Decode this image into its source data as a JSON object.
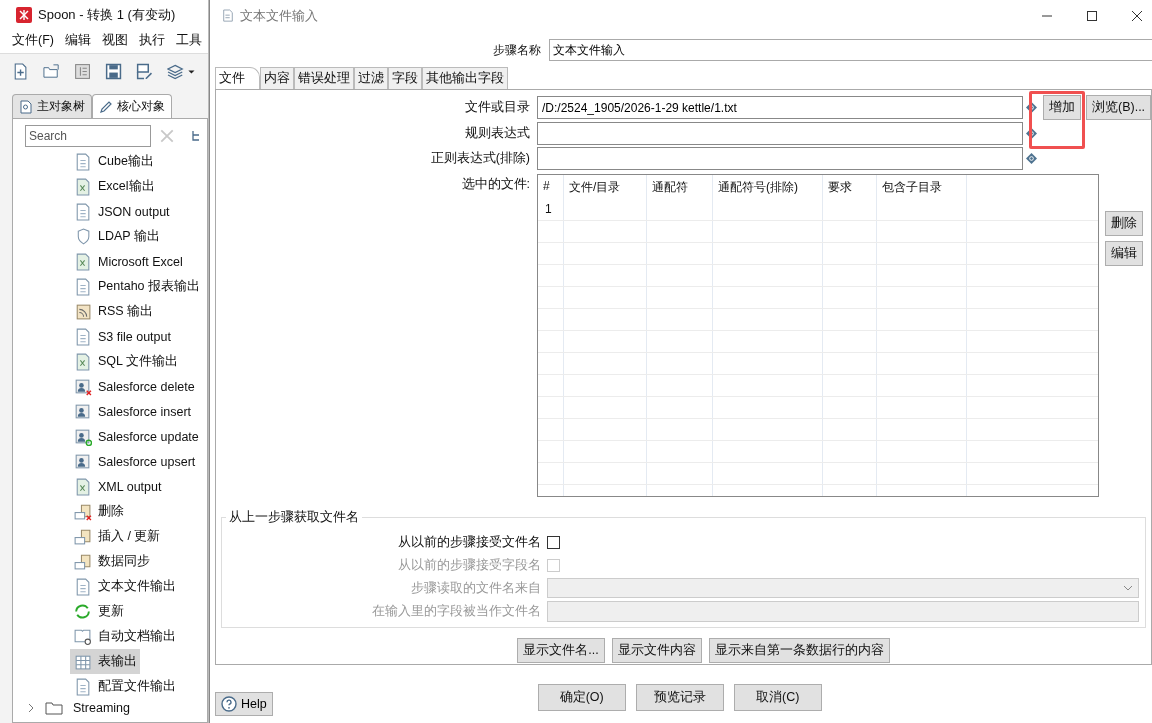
{
  "spoon": {
    "title": "Spoon - 转换 1 (有变动)",
    "menu": [
      "文件(F)",
      "编辑",
      "视图",
      "执行",
      "工具"
    ],
    "tabs": [
      {
        "label": "主对象树",
        "selected": false
      },
      {
        "label": "核心对象",
        "selected": true
      }
    ],
    "search": {
      "placeholder": "Search"
    },
    "tree": [
      {
        "label": "Cube输出",
        "kind": "doc",
        "selected": false
      },
      {
        "label": "Excel输出",
        "kind": "sheet",
        "selected": false
      },
      {
        "label": "JSON output",
        "kind": "doc",
        "selected": false
      },
      {
        "label": "LDAP 输出",
        "kind": "shield",
        "selected": false
      },
      {
        "label": "Microsoft Excel",
        "kind": "sheet",
        "selected": false
      },
      {
        "label": "Pentaho 报表输出",
        "kind": "doc",
        "selected": false
      },
      {
        "label": "RSS 输出",
        "kind": "rss",
        "selected": false
      },
      {
        "label": "S3 file output",
        "kind": "doc",
        "selected": false
      },
      {
        "label": "SQL 文件输出",
        "kind": "sheet",
        "selected": false
      },
      {
        "label": "Salesforce delete",
        "kind": "person-x",
        "selected": false
      },
      {
        "label": "Salesforce insert",
        "kind": "person",
        "selected": false
      },
      {
        "label": "Salesforce update",
        "kind": "person-sync",
        "selected": false
      },
      {
        "label": "Salesforce upsert",
        "kind": "person",
        "selected": false
      },
      {
        "label": "XML output",
        "kind": "sheet",
        "selected": false
      },
      {
        "label": "删除",
        "kind": "db-x",
        "selected": false
      },
      {
        "label": "插入 / 更新",
        "kind": "db",
        "selected": false
      },
      {
        "label": "数据同步",
        "kind": "db",
        "selected": false
      },
      {
        "label": "文本文件输出",
        "kind": "doc",
        "selected": false
      },
      {
        "label": "更新",
        "kind": "refresh",
        "selected": false
      },
      {
        "label": "自动文档输出",
        "kind": "book",
        "selected": false
      },
      {
        "label": "表输出",
        "kind": "table",
        "selected": true
      },
      {
        "label": "配置文件输出",
        "kind": "doc",
        "selected": false
      },
      {
        "label": "Streaming",
        "kind": "folder",
        "expanded": false
      }
    ]
  },
  "dialog": {
    "title": "文本文件输入",
    "step_name": {
      "label": "步骤名称",
      "value": "文本文件输入"
    },
    "tabs": [
      {
        "label": "文件",
        "selected": true
      },
      {
        "label": "内容",
        "selected": false
      },
      {
        "label": "错误处理",
        "selected": false
      },
      {
        "label": "过滤",
        "selected": false
      },
      {
        "label": "字段",
        "selected": false
      },
      {
        "label": "其他输出字段",
        "selected": false
      }
    ],
    "file": {
      "label": "文件或目录",
      "value": "/D:/2524_1905/2026-1-29 kettle/1.txt"
    },
    "regex": {
      "label": "规则表达式"
    },
    "exclude_regex": {
      "label": "正则表达式(排除)"
    },
    "add_button": {
      "label": "增加",
      "highlighted": true
    },
    "browse_button": "浏览(B)...",
    "selected_files": {
      "label": "选中的文件:",
      "columns": [
        "#",
        "文件/目录",
        "通配符",
        "通配符号(排除)",
        "要求",
        "包含子目录"
      ],
      "rows": [
        {
          "number": "1"
        }
      ]
    },
    "delete_button": "删除",
    "edit_button": "编辑",
    "from_previous": {
      "title": "从上一步骤获取文件名",
      "rows": [
        {
          "kind": "checkbox",
          "label": "从以前的步骤接受文件名",
          "checked": false,
          "disabled": false
        },
        {
          "kind": "checkbox",
          "label": "从以前的步骤接受字段名",
          "checked": false,
          "disabled": true
        },
        {
          "kind": "dropdown",
          "label": "步骤读取的文件名来自",
          "disabled": true
        },
        {
          "kind": "text",
          "label": "在输入里的字段被当作文件名",
          "disabled": true
        }
      ]
    },
    "show_buttons": [
      "显示文件名...",
      "显示文件内容",
      "显示来自第一条数据行的内容"
    ],
    "help": "Help",
    "buttons": [
      "确定(O)",
      "预览记录",
      "取消(C)"
    ]
  }
}
